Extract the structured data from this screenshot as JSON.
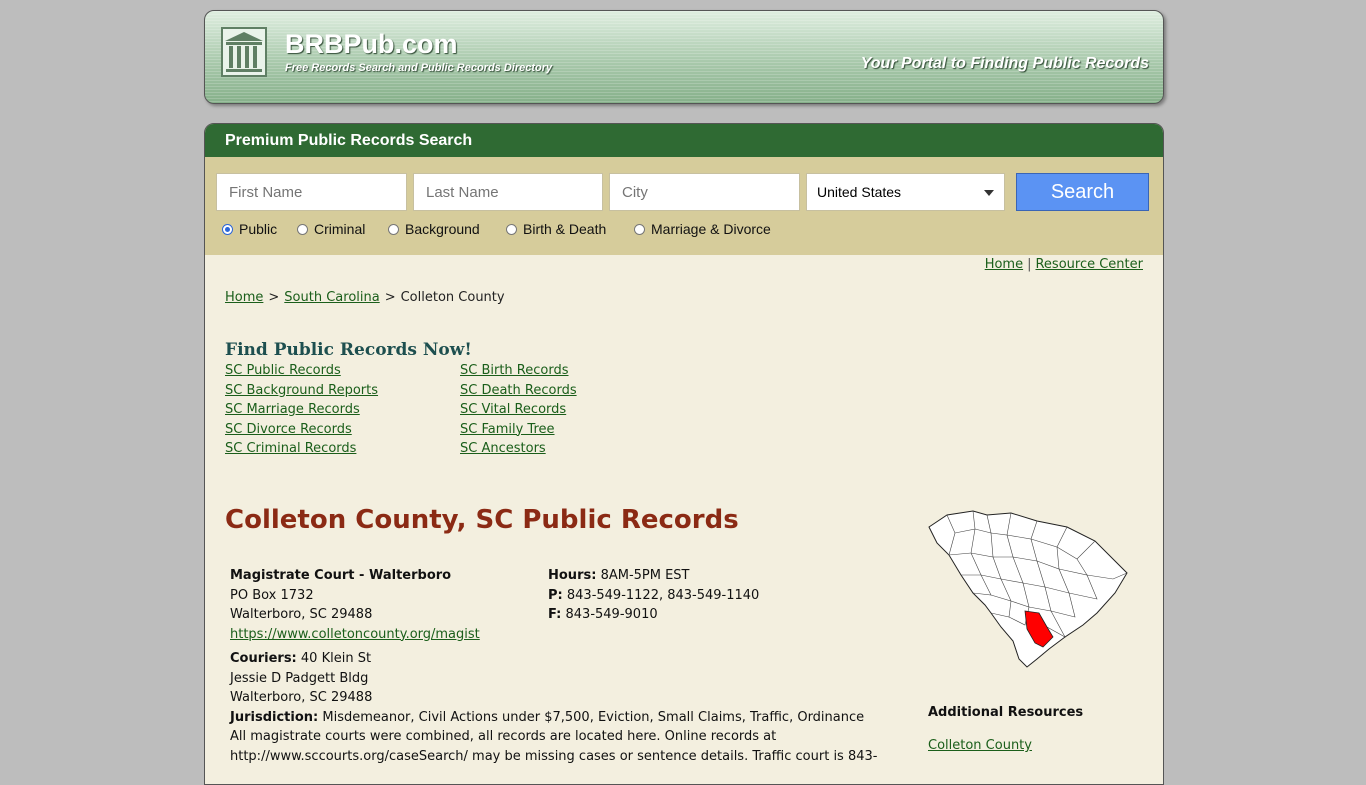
{
  "header": {
    "site_name": "BRBPub.com",
    "tagline": "Free Records Search and Public Records Directory",
    "portal_text": "Your Portal to Finding Public Records"
  },
  "search": {
    "title": "Premium Public Records Search",
    "first_name_placeholder": "First Name",
    "last_name_placeholder": "Last Name",
    "city_placeholder": "City",
    "country_selected": "United States",
    "button_label": "Search",
    "radio_options": [
      {
        "label": "Public",
        "selected": true
      },
      {
        "label": "Criminal",
        "selected": false
      },
      {
        "label": "Background",
        "selected": false
      },
      {
        "label": "Birth & Death",
        "selected": false
      },
      {
        "label": "Marriage & Divorce",
        "selected": false
      }
    ]
  },
  "topnav": {
    "home": "Home",
    "sep": "|",
    "resource": "Resource Center"
  },
  "breadcrumb": {
    "home": "Home",
    "gt": ">",
    "state": "South Carolina",
    "current": "Colleton County"
  },
  "find": {
    "heading": "Find Public Records Now!",
    "col1": [
      "SC Public Records",
      "SC Background Reports",
      "SC Marriage Records",
      "SC Divorce Records",
      "SC Criminal Records"
    ],
    "col2": [
      "SC Birth Records",
      "SC Death Records",
      "SC Vital Records",
      "SC Family Tree",
      "SC Ancestors"
    ]
  },
  "county": {
    "title": "Colleton County, SC Public Records",
    "office_name": "Magistrate Court - Walterboro",
    "address1": "PO Box 1732",
    "address2": "Walterboro, SC 29488",
    "url": "https://www.colletoncounty.org/magist",
    "hours_label": "Hours:",
    "hours": "8AM-5PM EST",
    "phone_label": "P:",
    "phone": "843-549-1122, 843-549-1140",
    "fax_label": "F:",
    "fax": "843-549-9010",
    "couriers_label": "Couriers:",
    "couriers1": "40 Klein St",
    "couriers2": "Jessie D Padgett Bldg",
    "couriers3": "Walterboro, SC 29488",
    "jurisdiction_label": "Jurisdiction:",
    "jurisdiction": "Misdemeanor, Civil Actions under $7,500, Eviction, Small Claims, Traffic, Ordinance",
    "note1": "All magistrate courts were combined, all records are located here. Online records at",
    "note2": "http://www.sccourts.org/caseSearch/ may be missing cases or sentence details. Traffic court is 843-"
  },
  "additional": {
    "heading": "Additional Resources",
    "link": "Colleton County"
  },
  "colors": {
    "green_bar": "#2f6a33",
    "tan": "#d6cc9b",
    "cream": "#f3efdf",
    "title_red": "#8b2a14",
    "highlight": "#ff0000"
  }
}
